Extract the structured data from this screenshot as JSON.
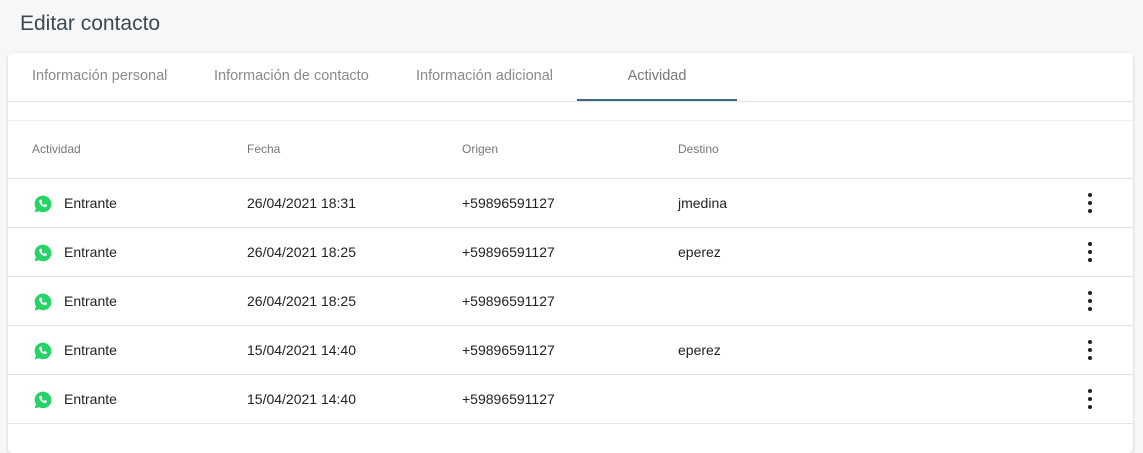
{
  "page": {
    "title": "Editar contacto"
  },
  "tabs": [
    {
      "label": "Información personal",
      "active": false
    },
    {
      "label": "Información de contacto",
      "active": false
    },
    {
      "label": "Información adicional",
      "active": false
    },
    {
      "label": "Actividad",
      "active": true
    }
  ],
  "table": {
    "headers": [
      "Actividad",
      "Fecha",
      "Origen",
      "Destino"
    ],
    "rows": [
      {
        "icon": "whatsapp-icon",
        "activity": "Entrante",
        "date": "26/04/2021 18:31",
        "origin": "+59896591127",
        "destination": "jmedina"
      },
      {
        "icon": "whatsapp-icon",
        "activity": "Entrante",
        "date": "26/04/2021 18:25",
        "origin": "+59896591127",
        "destination": "eperez"
      },
      {
        "icon": "whatsapp-icon",
        "activity": "Entrante",
        "date": "26/04/2021 18:25",
        "origin": "+59896591127",
        "destination": ""
      },
      {
        "icon": "whatsapp-icon",
        "activity": "Entrante",
        "date": "15/04/2021 14:40",
        "origin": "+59896591127",
        "destination": "eperez"
      },
      {
        "icon": "whatsapp-icon",
        "activity": "Entrante",
        "date": "15/04/2021 14:40",
        "origin": "+59896591127",
        "destination": ""
      }
    ]
  },
  "colors": {
    "accent": "#3d6a82",
    "whatsapp": "#25d366"
  }
}
